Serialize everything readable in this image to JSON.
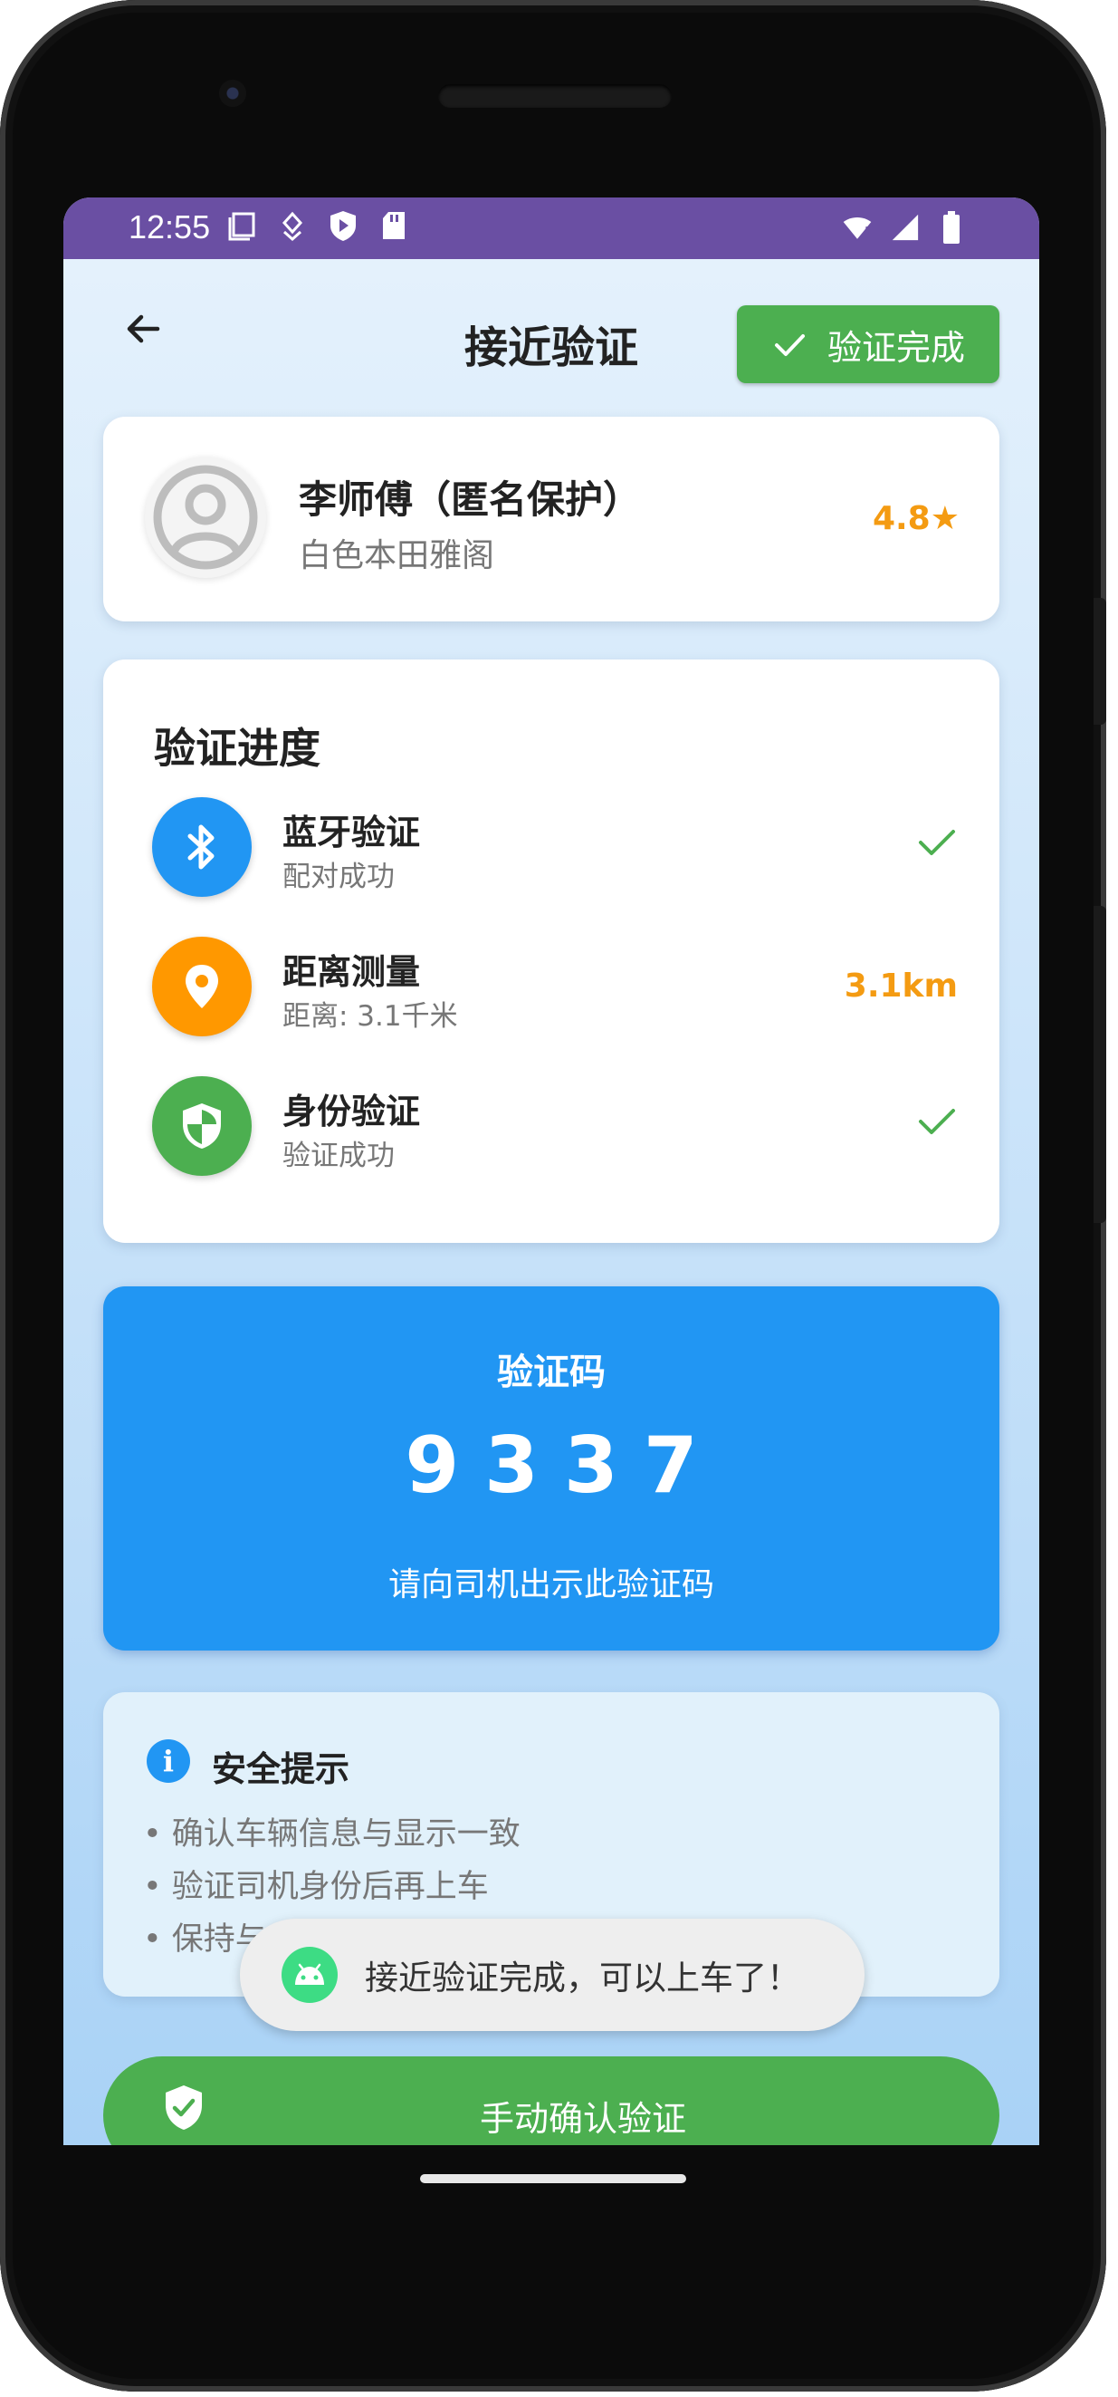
{
  "status_bar": {
    "time": "12:55",
    "left_icons": [
      "screen-icon",
      "accessibility-icon",
      "play-protect-icon",
      "sd-card-icon"
    ],
    "right_icons": [
      "wifi-icon",
      "signal-icon",
      "battery-icon"
    ]
  },
  "header": {
    "title": "接近验证",
    "done_label": "验证完成"
  },
  "driver": {
    "name": "李师傅（匿名保护）",
    "car": "白色本田雅阁",
    "rating": "4.8★"
  },
  "progress": {
    "title": "验证进度",
    "steps": [
      {
        "name": "蓝牙验证",
        "desc": "配对成功",
        "status": "",
        "icon": "bluetooth-icon",
        "color": "#2196f3"
      },
      {
        "name": "距离测量",
        "desc": "距离: 3.1千米",
        "status": "3.1km",
        "icon": "location-pin-icon",
        "color": "#ff9800"
      },
      {
        "name": "身份验证",
        "desc": "验证成功",
        "status": "",
        "icon": "shield-icon",
        "color": "#4caf50"
      }
    ]
  },
  "code": {
    "title": "验证码",
    "value": "9337",
    "hint": "请向司机出示此验证码"
  },
  "tips": {
    "title": "安全提示",
    "items": [
      "• 确认车辆信息与显示一致",
      "• 验证司机身份后再上车",
      "• 保持与"
    ]
  },
  "toast": {
    "message": "接近验证完成，可以上车了！"
  },
  "manual_confirm": {
    "label": "手动确认验证"
  },
  "colors": {
    "status_bar": "#6a4fa3",
    "accent_green": "#4caf50",
    "accent_blue": "#2196f3",
    "accent_orange": "#ff9800",
    "rating_orange": "#f49b12"
  }
}
